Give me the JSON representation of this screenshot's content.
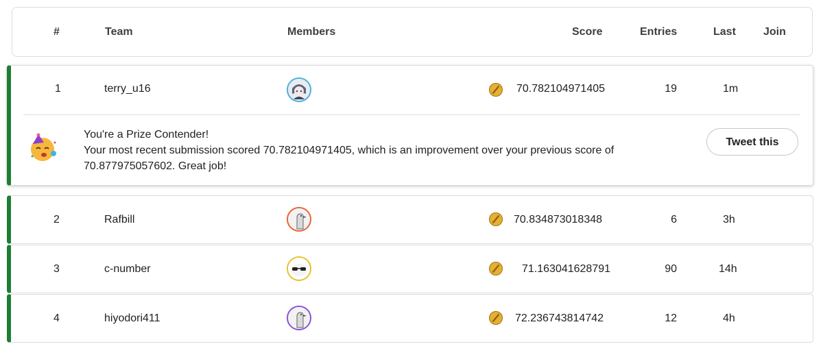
{
  "header": {
    "rank": "#",
    "team": "Team",
    "members": "Members",
    "score": "Score",
    "entries": "Entries",
    "last": "Last",
    "join": "Join"
  },
  "rows": [
    {
      "rank": "1",
      "team": "terry_u16",
      "score": "70.782104971405",
      "entries": "19",
      "last": "1m",
      "avatar_color": "#4ab0d9",
      "avatar_icon": "anime-avatar-icon"
    },
    {
      "rank": "2",
      "team": "Rafbill",
      "score": "70.834873018348",
      "entries": "6",
      "last": "3h",
      "avatar_color": "#e8622f",
      "avatar_icon": "goose-avatar-icon"
    },
    {
      "rank": "3",
      "team": "c-number",
      "score": "71.163041628791",
      "entries": "90",
      "last": "14h",
      "avatar_color": "#e6c229",
      "avatar_icon": "sunglasses-avatar-icon"
    },
    {
      "rank": "4",
      "team": "hiyodori411",
      "score": "72.236743814742",
      "entries": "12",
      "last": "4h",
      "avatar_color": "#8a4fd8",
      "avatar_icon": "goose-avatar-icon"
    }
  ],
  "message": {
    "title": "You're a Prize Contender!",
    "line1": "Your most recent submission scored 70.782104971405, which is an improvement over your previous score of",
    "line2": "70.877975057602. Great job!",
    "tweet_label": "Tweet this",
    "emoji_icon": "party-face-icon"
  },
  "colors": {
    "accent_green": "#1e7d32",
    "medal_gold": "#c8901a"
  }
}
